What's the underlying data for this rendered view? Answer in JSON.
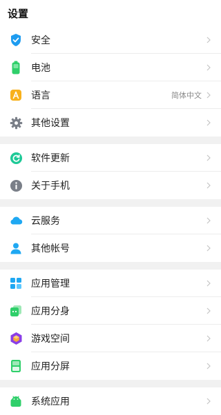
{
  "header": {
    "title": "设置"
  },
  "groups": [
    {
      "items": [
        {
          "label": "安全",
          "icon": "shield-icon"
        },
        {
          "label": "电池",
          "icon": "battery-icon"
        },
        {
          "label": "语言",
          "icon": "language-icon",
          "value": "简体中文"
        },
        {
          "label": "其他设置",
          "icon": "gear-icon"
        }
      ]
    },
    {
      "items": [
        {
          "label": "软件更新",
          "icon": "update-icon"
        },
        {
          "label": "关于手机",
          "icon": "info-icon"
        }
      ]
    },
    {
      "items": [
        {
          "label": "云服务",
          "icon": "cloud-icon"
        },
        {
          "label": "其他帐号",
          "icon": "person-icon"
        }
      ]
    },
    {
      "items": [
        {
          "label": "应用管理",
          "icon": "app-grid-icon"
        },
        {
          "label": "应用分身",
          "icon": "app-clone-icon"
        },
        {
          "label": "游戏空间",
          "icon": "game-cube-icon"
        },
        {
          "label": "应用分屏",
          "icon": "split-screen-icon"
        }
      ]
    },
    {
      "items": [
        {
          "label": "系统应用",
          "icon": "android-icon"
        }
      ]
    }
  ],
  "colors": {
    "background": "#ffffff",
    "separator": "#f1f1f1",
    "text": "#222222",
    "secondary_text": "#8a8a8a",
    "chevron": "#c4c4c4"
  }
}
